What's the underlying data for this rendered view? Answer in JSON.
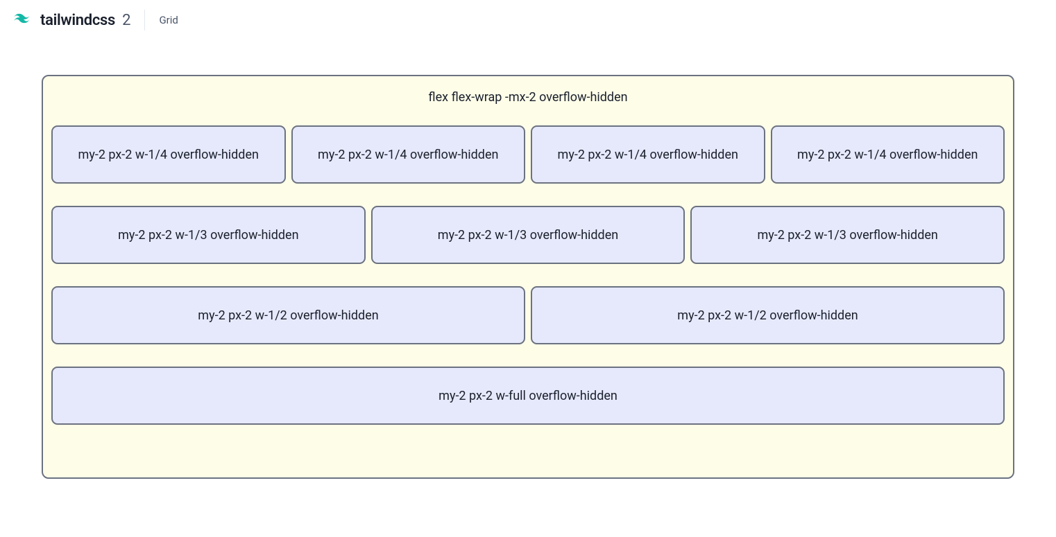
{
  "header": {
    "brand": "tailwindcss",
    "version": "2",
    "subtitle": "Grid"
  },
  "container": {
    "label": "flex flex-wrap -mx-2 overflow-hidden"
  },
  "cells": {
    "row1": [
      "my-2 px-2 w-1/4 overflow-hidden",
      "my-2 px-2 w-1/4 overflow-hidden",
      "my-2 px-2 w-1/4 overflow-hidden",
      "my-2 px-2 w-1/4 overflow-hidden"
    ],
    "row2": [
      "my-2 px-2 w-1/3 overflow-hidden",
      "my-2 px-2 w-1/3 overflow-hidden",
      "my-2 px-2 w-1/3 overflow-hidden"
    ],
    "row3": [
      "my-2 px-2 w-1/2 overflow-hidden",
      "my-2 px-2 w-1/2 overflow-hidden"
    ],
    "row4": [
      "my-2 px-2 w-full overflow-hidden"
    ]
  }
}
